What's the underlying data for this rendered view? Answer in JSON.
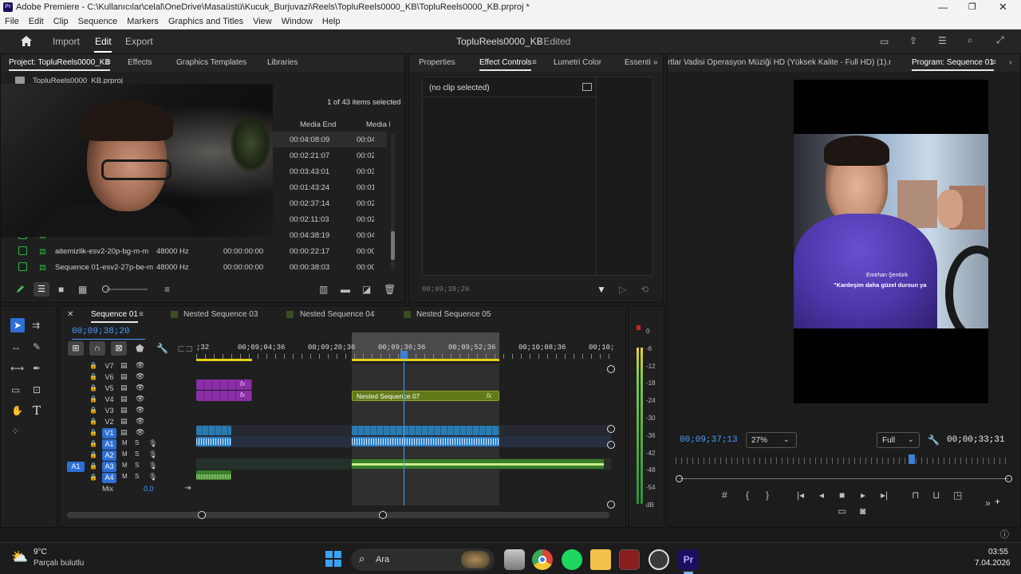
{
  "window": {
    "title": "Adobe Premiere - C:\\Kullanıcılar\\celal\\OneDrive\\Masaüstü\\Kucuk_Burjuvazi\\Reels\\TopluReels0000_KB\\TopluReels0000_KB.prproj *"
  },
  "menu": [
    "File",
    "Edit",
    "Clip",
    "Sequence",
    "Markers",
    "Graphics and Titles",
    "View",
    "Window",
    "Help"
  ],
  "header": {
    "import": "Import",
    "edit": "Edit",
    "export": "Export",
    "doc_title": "TopluReels0000_KB",
    "doc_status": "- Edited"
  },
  "project": {
    "tabs": [
      "Project: TopluReels0000_KB",
      "Effects",
      "Graphics Templates",
      "Libraries"
    ],
    "file": "TopluReels0000_KB.prproj",
    "selection": "1 of 43 items selected",
    "columns": [
      "Media End",
      "Media D"
    ],
    "rows": [
      {
        "name": "",
        "rate": "",
        "start": "",
        "end": "00:04:08:09",
        "dur": "00:04"
      },
      {
        "name": "",
        "rate": "",
        "start": "",
        "end": "00:02:21:07",
        "dur": "00:02"
      },
      {
        "name": "",
        "rate": "",
        "start": "",
        "end": "00:03:43:01",
        "dur": "00:03"
      },
      {
        "name": "",
        "rate": "",
        "start": "",
        "end": "00:01:43:24",
        "dur": "00:01"
      },
      {
        "name": "",
        "rate": "",
        "start": "",
        "end": "00:02:37:14",
        "dur": "00:02"
      },
      {
        "name": "",
        "rate": "",
        "start": "",
        "end": "00:02:11:03",
        "dur": "00:02"
      },
      {
        "name": "",
        "rate": "",
        "start": "",
        "end": "00:04:38:19",
        "dur": "00:04"
      },
      {
        "name": "aitemizlik-esv2-20p-bg-m-m",
        "rate": "48000 Hz",
        "start": "00:00:00:00",
        "end": "00:00:22:17",
        "dur": "00:00"
      },
      {
        "name": "Sequence 01-esv2-27p-be-m",
        "rate": "48000 Hz",
        "start": "00:00:00:00",
        "end": "00:00:38:03",
        "dur": "00:00"
      }
    ]
  },
  "effect_controls": {
    "tabs": [
      "Properties",
      "Effect Controls",
      "Lumetri Color",
      "Essenti"
    ],
    "empty": "(no clip selected)",
    "timecode": "00;09;38;20"
  },
  "source_tab": "rtlar Vadisi Operasyon Müziği HD (Yüksek Kalite - Full HD) (1).mp3",
  "program": {
    "tab": "Program: Sequence 01",
    "timecode": "00;09;37;13",
    "zoom": "27%",
    "quality": "Full",
    "duration": "00;00;33;31",
    "caption_name": "Emirhan Şentürk",
    "caption_text": "\"Kardeşim daha güzel dursun ya"
  },
  "timeline": {
    "tabs": [
      "Sequence 01",
      "Nested Sequence 03",
      "Nested Sequence 04",
      "Nested Sequence 05"
    ],
    "timecode": "00;09;38;20",
    "ruler": [
      ";32",
      "00;09;04;36",
      "00;09;20;36",
      "00;09;36;36",
      "00;09;52;36",
      "00;10;08;36",
      "00;10;"
    ],
    "video_tracks": [
      "V7",
      "V6",
      "V5",
      "V4",
      "V3",
      "V2",
      "V1"
    ],
    "audio_tracks": [
      "A1",
      "A2",
      "A3",
      "A4"
    ],
    "src_patch": "A1",
    "mix_label": "Mix",
    "mix_value": "0,0",
    "nested_clip": "Nested Sequence 07",
    "fx": "fx"
  },
  "meter": {
    "scale": [
      "0",
      "-6",
      "-12",
      "-18",
      "-24",
      "-30",
      "-36",
      "-42",
      "-48",
      "-54",
      "dB"
    ]
  },
  "taskbar": {
    "temp": "9°C",
    "weather": "Parçalı bulutlu",
    "search": "Ara",
    "time": "03:55",
    "date": "7.04.2026"
  },
  "colors": {
    "accent": "#2d8ceb",
    "nested": "#627a1a",
    "purple": "#7a2896",
    "audio": "#2e7fc4",
    "green_audio": "#3a7d2a"
  }
}
